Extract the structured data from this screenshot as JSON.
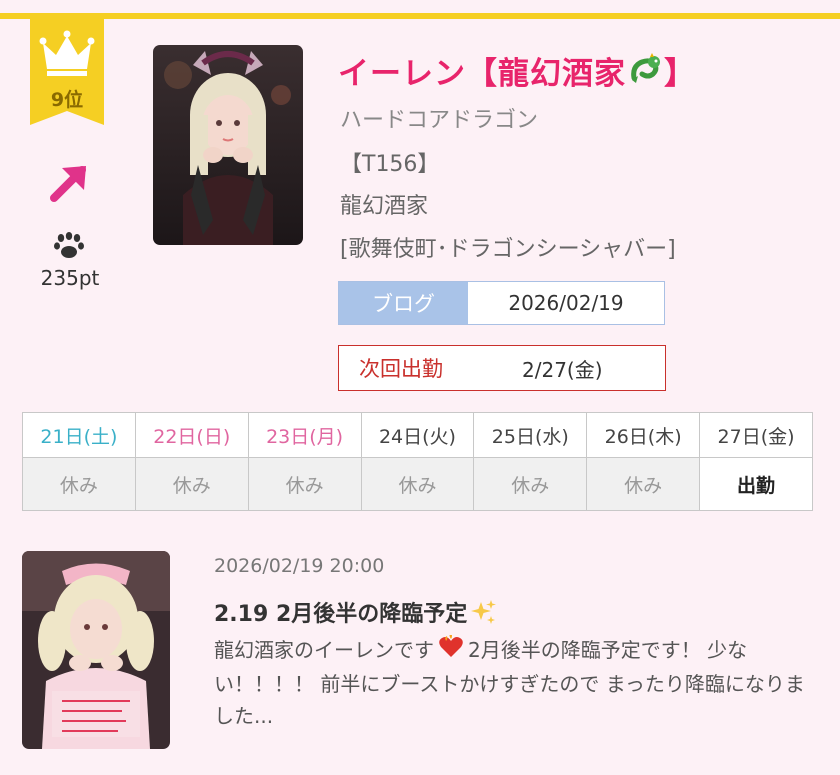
{
  "rank": {
    "label": "9位",
    "icon": "crown-icon",
    "trend_icon": "up-right-arrow-icon",
    "points_icon": "paw-icon",
    "points": "235pt",
    "badge_color": "#f5cf23"
  },
  "cast": {
    "name": "イーレン【龍幻酒家",
    "name_suffix": "】",
    "name_emoji": "dragon-icon",
    "catchphrase": "ハードコアドラゴン",
    "height": "【T156】",
    "store": "龍幻酒家",
    "area": "[歌舞伎町･ドラゴンシーシャバー]",
    "name_color": "#e8246b"
  },
  "blog": {
    "label": "ブログ",
    "date": "2026/02/19"
  },
  "next_shift": {
    "label": "次回出勤",
    "value": "2/27(金)"
  },
  "schedule": {
    "days": [
      "21日(土)",
      "22日(日)",
      "23日(月)",
      "24日(火)",
      "25日(水)",
      "26日(木)",
      "27日(金)"
    ],
    "status": [
      "休み",
      "休み",
      "休み",
      "休み",
      "休み",
      "休み",
      "出勤"
    ]
  },
  "post": {
    "time": "2026/02/19 20:00",
    "title": "2.19 2月後半の降臨予定",
    "body_start": "龍幻酒家のイーレンです",
    "body_rest": "2月後半の降臨予定です！ 少ない！！！！ 前半にブーストかけすぎたので まったり降臨になりました...",
    "title_emoji": "sparkles-icon",
    "body_emoji": "heart-on-fire-icon"
  }
}
